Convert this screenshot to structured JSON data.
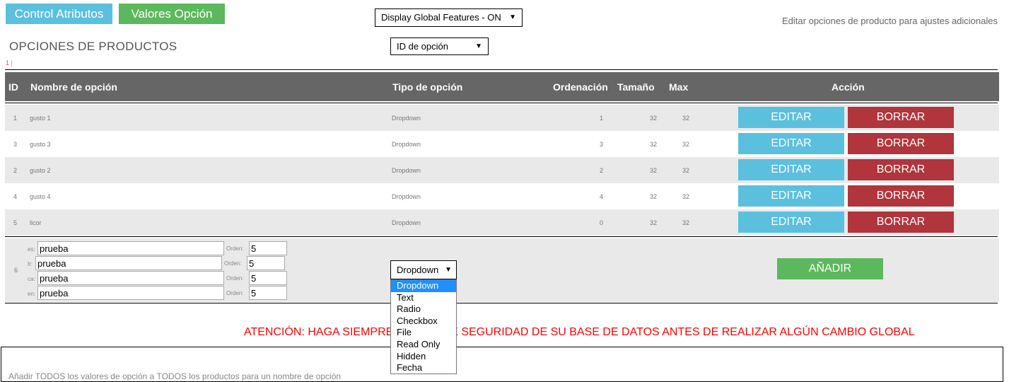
{
  "tabs": {
    "attributes": "Control Atributos",
    "values": "Valores Opción"
  },
  "global_select": {
    "value": "Display Global Features - ON"
  },
  "sort_select": {
    "value": "ID de opción"
  },
  "hint": "Editar opciones de producto para ajustes adicionales",
  "section_title": "OPCIONES DE PRODUCTOS",
  "pager": {
    "current": "1",
    "separator": "|"
  },
  "table": {
    "headers": {
      "id": "ID",
      "name": "Nombre de opción",
      "type": "Tipo de opción",
      "order": "Ordenación",
      "size": "Tamaño",
      "max": "Max",
      "action": "Acción"
    },
    "rows": [
      {
        "id": "1",
        "name": "gusto 1",
        "type": "Dropdown",
        "order": "1",
        "size": "32",
        "max": "32"
      },
      {
        "id": "3",
        "name": "gusto 3",
        "type": "Dropdown",
        "order": "3",
        "size": "32",
        "max": "32"
      },
      {
        "id": "2",
        "name": "gusto 2",
        "type": "Dropdown",
        "order": "2",
        "size": "32",
        "max": "32"
      },
      {
        "id": "4",
        "name": "gusto 4",
        "type": "Dropdown",
        "order": "4",
        "size": "32",
        "max": "32"
      },
      {
        "id": "5",
        "name": "licor",
        "type": "Dropdown",
        "order": "0",
        "size": "32",
        "max": "32"
      }
    ],
    "edit_label": "EDITAR",
    "delete_label": "BORRAR"
  },
  "add_form": {
    "id": "6",
    "order_label": "Orden:",
    "languages": [
      {
        "code": "es:",
        "name": "prueba",
        "order": "5"
      },
      {
        "code": "fr:",
        "name": "prueba",
        "order": "5"
      },
      {
        "code": "ca:",
        "name": "prueba",
        "order": "5"
      },
      {
        "code": "en:",
        "name": "prueba",
        "order": "5"
      }
    ],
    "type_value": "Dropdown",
    "type_options": [
      "Dropdown",
      "Text",
      "Radio",
      "Checkbox",
      "File",
      "Read Only",
      "Hidden",
      "Fecha"
    ],
    "add_label": "AÑADIR"
  },
  "warning": "ATENCIÓN: HAGA SIEMPRE COPIAS DE SEGURIDAD DE SU BASE DE DATOS ANTES DE REALIZAR ALGÚN CAMBIO GLOBAL",
  "bottom_text": "Añadir TODOS los valores de opción a TODOS los productos para un nombre de opción",
  "colors": {
    "info": "#5bc0de",
    "success": "#5cb85c",
    "danger": "#b0353c",
    "header_bg": "#666666",
    "warning_text": "#ff0000"
  }
}
